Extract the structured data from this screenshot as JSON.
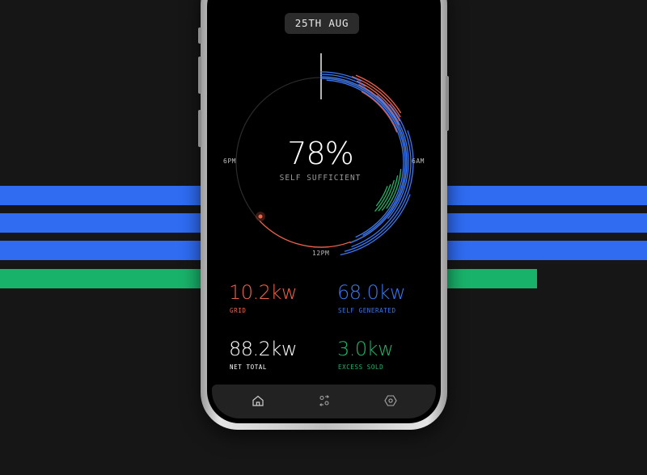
{
  "header": {
    "date": "25TH AUG"
  },
  "dial": {
    "percent": "78%",
    "subtitle": "SELF SUFFICIENT",
    "time_labels": {
      "left": "6PM",
      "right": "6AM",
      "bottom": "12PM"
    }
  },
  "stats": [
    {
      "value": "10.2kw",
      "label": "GRID",
      "color": "#f0614a"
    },
    {
      "value": "68.0kw",
      "label": "SELF GENERATED",
      "color": "#3a78f2"
    },
    {
      "value": "88.2kw",
      "label": "NET TOTAL",
      "color": "#ffffff"
    },
    {
      "value": "3.0kw",
      "label": "EXCESS SOLD",
      "color": "#1eb56a"
    }
  ],
  "tabs": [
    {
      "icon": "home-icon"
    },
    {
      "icon": "people-swap-icon"
    },
    {
      "icon": "settings-hex-icon"
    }
  ],
  "colors": {
    "grid": "#f0614a",
    "self_generated": "#3a78f2",
    "excess": "#1eb56a",
    "background": "#161616"
  }
}
